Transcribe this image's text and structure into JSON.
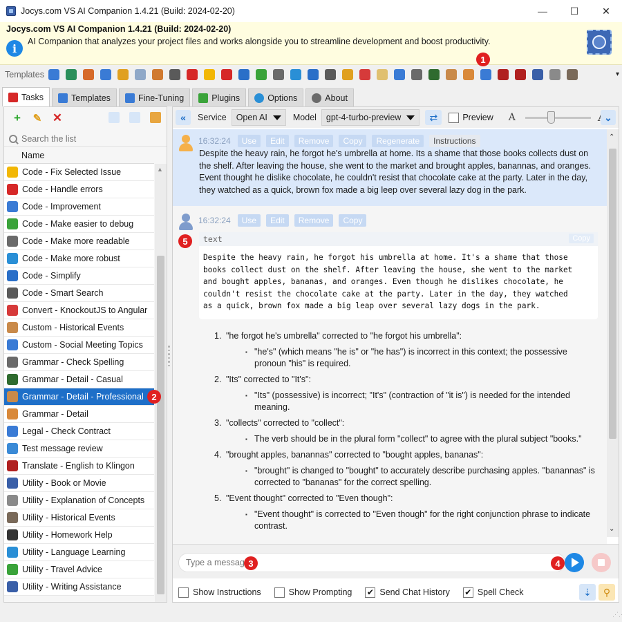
{
  "window": {
    "title": "Jocys.com VS AI Companion 1.4.21 (Build: 2024-02-20)",
    "controls": [
      "minimize-icon",
      "maximize-icon",
      "close-icon"
    ]
  },
  "banner": {
    "title": "Jocys.com VS AI Companion 1.4.21 (Build: 2024-02-20)",
    "description": "AI Companion that analyzes your project files and works alongside you to streamline development and boost productivity."
  },
  "toolbar": {
    "label": "Templates",
    "icons": [
      "chat-icon",
      "equalizer-icon",
      "shapes-icon",
      "code-icon",
      "brush-icon",
      "document-icon",
      "chart-icon",
      "search-icon",
      "error-icon",
      "warning-icon",
      "alert-icon",
      "globe-icon",
      "ball-icon",
      "glasses-icon",
      "shield-icon",
      "arrow-icon",
      "magnifier-icon",
      "puzzle-icon",
      "knockout-icon",
      "note-icon",
      "users-icon",
      "abc-icon",
      "person-icon",
      "person-icon",
      "teacher-icon",
      "legal-icon",
      "bug-icon",
      "klingon-icon",
      "film-icon",
      "concept-icon",
      "history-icon"
    ]
  },
  "badges": [
    "1",
    "2",
    "3",
    "4",
    "5"
  ],
  "tabs": [
    {
      "label": "Tasks",
      "icon": "tasks-icon",
      "active": true
    },
    {
      "label": "Templates",
      "icon": "templates-icon",
      "active": false
    },
    {
      "label": "Fine-Tuning",
      "icon": "tuning-icon",
      "active": false
    },
    {
      "label": "Plugins",
      "icon": "plugins-icon",
      "active": false
    },
    {
      "label": "Options",
      "icon": "gear-icon",
      "active": false
    },
    {
      "label": "About",
      "icon": "help-icon",
      "active": false
    }
  ],
  "left": {
    "search_placeholder": "Search the list",
    "column": "Name",
    "items": [
      {
        "label": "Code - Fix Selected Issue",
        "icon": "warning-icon",
        "color": "#f2b705"
      },
      {
        "label": "Code - Handle errors",
        "icon": "error-icon",
        "color": "#d62828"
      },
      {
        "label": "Code - Improvement",
        "icon": "code-icon",
        "color": "#3a7bd5"
      },
      {
        "label": "Code - Make easier to debug",
        "icon": "ball-icon",
        "color": "#3aa33a"
      },
      {
        "label": "Code - Make more readable",
        "icon": "glasses-icon",
        "color": "#6a6a6a"
      },
      {
        "label": "Code - Make more robust",
        "icon": "shield-icon",
        "color": "#2a8fd6"
      },
      {
        "label": "Code - Simplify",
        "icon": "arrow-icon",
        "color": "#2a6fc8"
      },
      {
        "label": "Code - Smart Search",
        "icon": "magnifier-icon",
        "color": "#5a5a5a"
      },
      {
        "label": "Convert - KnockoutJS to Angular",
        "icon": "knockout-icon",
        "color": "#d63a3a"
      },
      {
        "label": "Custom - Historical Events",
        "icon": "clock-icon",
        "color": "#c98a4a"
      },
      {
        "label": "Custom - Social Meeting Topics",
        "icon": "users-icon",
        "color": "#3a7bd5"
      },
      {
        "label": "Grammar - Check Spelling",
        "icon": "abc-icon",
        "color": "#6a6a6a"
      },
      {
        "label": "Grammar - Detail - Casual",
        "icon": "person-icon",
        "color": "#2f6b2f"
      },
      {
        "label": "Grammar - Detail - Professional",
        "icon": "person-icon",
        "color": "#c98a4a",
        "selected": true
      },
      {
        "label": "Grammar - Detail",
        "icon": "teacher-icon",
        "color": "#d9893a"
      },
      {
        "label": "Legal - Check Contract",
        "icon": "legal-icon",
        "color": "#3a7bd5"
      },
      {
        "label": "Test message review",
        "icon": "chat-icon",
        "color": "#3a8ad6"
      },
      {
        "label": "Translate - English to Klingon",
        "icon": "klingon-icon",
        "color": "#b02020"
      },
      {
        "label": "Utility - Book or Movie",
        "icon": "film-icon",
        "color": "#3a5fa8"
      },
      {
        "label": "Utility - Explanation of Concepts",
        "icon": "concept-icon",
        "color": "#8a8a8a"
      },
      {
        "label": "Utility - Historical Events",
        "icon": "history-icon",
        "color": "#7a6a5a"
      },
      {
        "label": "Utility - Homework Help",
        "icon": "homework-icon",
        "color": "#333333"
      },
      {
        "label": "Utility - Language Learning",
        "icon": "globe-icon",
        "color": "#2a8fd6"
      },
      {
        "label": "Utility - Travel Advice",
        "icon": "map-icon",
        "color": "#3aa33a"
      },
      {
        "label": "Utility - Writing Assistance",
        "icon": "pen-icon",
        "color": "#3a5fa8"
      }
    ]
  },
  "right": {
    "service_label": "Service",
    "service_value": "Open AI",
    "model_label": "Model",
    "model_value": "gpt-4-turbo-preview",
    "preview_label": "Preview",
    "font_small": "A",
    "font_large": "A",
    "font_slider": 0.38
  },
  "chat": {
    "user_msg": {
      "time": "16:32:24",
      "buttons": [
        "Use",
        "Edit",
        "Remove",
        "Copy",
        "Regenerate",
        "Instructions"
      ],
      "text": "Despite the heavy rain, he forgot he's umbrella at home. Its a shame that those books collects dust on the shelf. After leaving the house, she went to the market and brought apples, banannas, and oranges. Event thought he dislike chocolate, he couldn't resist that chocolate cake at the party. Later in the day, they watched as a quick, brown fox made a big leep over several lazy dog in the park."
    },
    "ai_msg": {
      "time": "16:32:24",
      "buttons": [
        "Use",
        "Edit",
        "Remove",
        "Copy"
      ],
      "code_lang": "text",
      "code_copy": "Copy",
      "code_text": "Despite the heavy rain, he forgot his umbrella at home. It's a shame that those\nbooks collect dust on the shelf. After leaving the house, she went to the market\nand bought apples, bananas, and oranges. Even though he dislikes chocolate, he\ncouldn't resist the chocolate cake at the party. Later in the day, they watched\nas a quick, brown fox made a big leap over several lazy dogs in the park.",
      "corrections": [
        {
          "num": "1.",
          "title": "\"he forgot he's umbrella\" corrected to \"he forgot his umbrella\":",
          "detail": "\"he's\" (which means \"he is\" or \"he has\") is incorrect in this context; the possessive pronoun \"his\" is required."
        },
        {
          "num": "2.",
          "title": "\"Its\" corrected to \"It's\":",
          "detail": "\"Its\" (possessive) is incorrect; \"It's\" (contraction of \"it is\") is needed for the intended meaning."
        },
        {
          "num": "3.",
          "title": "\"collects\" corrected to \"collect\":",
          "detail": "The verb should be in the plural form \"collect\" to agree with the plural subject \"books.\""
        },
        {
          "num": "4.",
          "title": "\"brought apples, banannas\" corrected to \"bought apples, bananas\":",
          "detail": "\"brought\" is changed to \"bought\" to accurately describe purchasing apples. \"banannas\" is corrected to \"bananas\" for the correct spelling."
        },
        {
          "num": "5.",
          "title": "\"Event thought\" corrected to \"Even though\":",
          "detail": "\"Event thought\" is corrected to \"Even though\" for the right conjunction phrase to indicate contrast."
        }
      ]
    }
  },
  "input": {
    "placeholder": "Type a message"
  },
  "options": [
    {
      "label": "Show Instructions",
      "checked": false
    },
    {
      "label": "Show Prompting",
      "checked": false
    },
    {
      "label": "Send Chat History",
      "checked": true
    },
    {
      "label": "Spell Check",
      "checked": true
    }
  ],
  "colors": {
    "accent": "#1e6fc8",
    "badge": "#e02020",
    "banner_bg": "#fffde0",
    "user_msg_bg": "#dbe8fa"
  }
}
